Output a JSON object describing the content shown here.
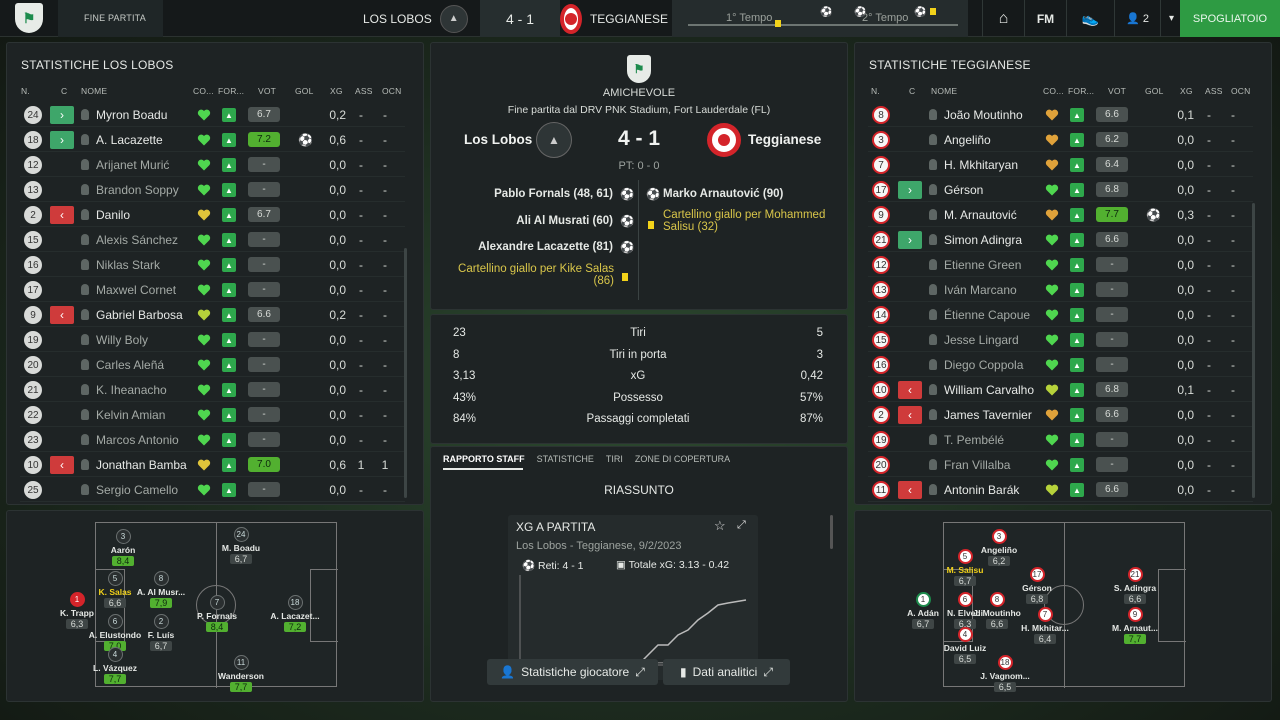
{
  "topbar": {
    "section": "FINE PARTITA",
    "home_team": "LOS LOBOS",
    "score": "4 - 1",
    "away_team": "TEGGIANESE",
    "first_half": "1° Tempo",
    "second_half": "2° Tempo",
    "fm": "FM",
    "users_count": "2",
    "dressing_room": "SPOGLIATOIO"
  },
  "left": {
    "title": "STATISTICHE LOS LOBOS",
    "headers": {
      "n": "N.",
      "c": "C",
      "name": "NOME",
      "co": "CO...",
      "form": "FOR...",
      "vot": "VOT",
      "gol": "GOL",
      "xg": "XG",
      "ass": "ASS",
      "ocn": "OCN"
    },
    "players": [
      {
        "n": "24",
        "sub": "in",
        "name": "Myron Boadu",
        "heart": "green",
        "vot": "6.7",
        "hi": false,
        "gol": "",
        "xg": "0,2",
        "ass": "-",
        "ocn": "-"
      },
      {
        "n": "18",
        "sub": "in",
        "name": "A. Lacazette",
        "heart": "green",
        "vot": "7.2",
        "hi": true,
        "gol": "⚽",
        "xg": "0,6",
        "ass": "-",
        "ocn": "-"
      },
      {
        "n": "12",
        "sub": "",
        "name": "Arijanet Murić",
        "heart": "green",
        "vot": "-",
        "hi": false,
        "gol": "",
        "xg": "0,0",
        "ass": "-",
        "ocn": "-"
      },
      {
        "n": "13",
        "sub": "",
        "name": "Brandon Soppy",
        "heart": "green",
        "vot": "-",
        "hi": false,
        "gol": "",
        "xg": "0,0",
        "ass": "-",
        "ocn": "-"
      },
      {
        "n": "2",
        "sub": "out",
        "name": "Danilo",
        "heart": "yellow",
        "vot": "6.7",
        "hi": false,
        "gol": "",
        "xg": "0,0",
        "ass": "-",
        "ocn": "-"
      },
      {
        "n": "15",
        "sub": "",
        "name": "Alexis Sánchez",
        "heart": "green",
        "vot": "-",
        "hi": false,
        "gol": "",
        "xg": "0,0",
        "ass": "-",
        "ocn": "-"
      },
      {
        "n": "16",
        "sub": "",
        "name": "Niklas Stark",
        "heart": "green",
        "vot": "-",
        "hi": false,
        "gol": "",
        "xg": "0,0",
        "ass": "-",
        "ocn": "-"
      },
      {
        "n": "17",
        "sub": "",
        "name": "Maxwel Cornet",
        "heart": "green",
        "vot": "-",
        "hi": false,
        "gol": "",
        "xg": "0,0",
        "ass": "-",
        "ocn": "-"
      },
      {
        "n": "9",
        "sub": "out",
        "name": "Gabriel Barbosa",
        "heart": "lime",
        "vot": "6.6",
        "hi": false,
        "gol": "",
        "xg": "0,2",
        "ass": "-",
        "ocn": "-"
      },
      {
        "n": "19",
        "sub": "",
        "name": "Willy Boly",
        "heart": "green",
        "vot": "-",
        "hi": false,
        "gol": "",
        "xg": "0,0",
        "ass": "-",
        "ocn": "-"
      },
      {
        "n": "20",
        "sub": "",
        "name": "Carles Aleñá",
        "heart": "green",
        "vot": "-",
        "hi": false,
        "gol": "",
        "xg": "0,0",
        "ass": "-",
        "ocn": "-"
      },
      {
        "n": "21",
        "sub": "",
        "name": "K. Iheanacho",
        "heart": "green",
        "vot": "-",
        "hi": false,
        "gol": "",
        "xg": "0,0",
        "ass": "-",
        "ocn": "-"
      },
      {
        "n": "22",
        "sub": "",
        "name": "Kelvin Amian",
        "heart": "green",
        "vot": "-",
        "hi": false,
        "gol": "",
        "xg": "0,0",
        "ass": "-",
        "ocn": "-"
      },
      {
        "n": "23",
        "sub": "",
        "name": "Marcos Antonio",
        "heart": "green",
        "vot": "-",
        "hi": false,
        "gol": "",
        "xg": "0,0",
        "ass": "-",
        "ocn": "-"
      },
      {
        "n": "10",
        "sub": "out",
        "name": "Jonathan Bamba",
        "heart": "yellow",
        "vot": "7.0",
        "hi": true,
        "gol": "",
        "xg": "0,6",
        "ass": "1",
        "ocn": "1"
      },
      {
        "n": "25",
        "sub": "",
        "name": "Sergio Camello",
        "heart": "green",
        "vot": "-",
        "hi": false,
        "gol": "",
        "xg": "0,0",
        "ass": "-",
        "ocn": "-"
      }
    ]
  },
  "right": {
    "title": "STATISTICHE TEGGIANESE",
    "headers": {
      "n": "N.",
      "c": "C",
      "name": "NOME",
      "co": "CO...",
      "form": "FOR...",
      "vot": "VOT",
      "gol": "GOL",
      "xg": "XG",
      "ass": "ASS",
      "ocn": "OCN"
    },
    "players": [
      {
        "n": "8",
        "sub": "",
        "name": "João Moutinho",
        "heart": "orange",
        "vot": "6.6",
        "hi": false,
        "gol": "",
        "xg": "0,1",
        "ass": "-",
        "ocn": "-"
      },
      {
        "n": "3",
        "sub": "",
        "name": "Angeliño",
        "heart": "orange",
        "vot": "6.2",
        "hi": false,
        "gol": "",
        "xg": "0,0",
        "ass": "-",
        "ocn": "-"
      },
      {
        "n": "7",
        "sub": "",
        "name": "H. Mkhitaryan",
        "heart": "orange",
        "vot": "6.4",
        "hi": false,
        "gol": "",
        "xg": "0,0",
        "ass": "-",
        "ocn": "-"
      },
      {
        "n": "17",
        "sub": "in",
        "name": "Gérson",
        "heart": "green",
        "vot": "6.8",
        "hi": false,
        "gol": "",
        "xg": "0,0",
        "ass": "-",
        "ocn": "-"
      },
      {
        "n": "9",
        "sub": "",
        "name": "M. Arnautović",
        "heart": "orange",
        "vot": "7.7",
        "hi": true,
        "gol": "⚽",
        "xg": "0,3",
        "ass": "-",
        "ocn": "-"
      },
      {
        "n": "21",
        "sub": "in",
        "name": "Simon Adingra",
        "heart": "green",
        "vot": "6.6",
        "hi": false,
        "gol": "",
        "xg": "0,0",
        "ass": "-",
        "ocn": "-"
      },
      {
        "n": "12",
        "sub": "",
        "name": "Etienne Green",
        "heart": "green",
        "vot": "-",
        "hi": false,
        "gol": "",
        "xg": "0,0",
        "ass": "-",
        "ocn": "-"
      },
      {
        "n": "13",
        "sub": "",
        "name": "Iván Marcano",
        "heart": "green",
        "vot": "-",
        "hi": false,
        "gol": "",
        "xg": "0,0",
        "ass": "-",
        "ocn": "-"
      },
      {
        "n": "14",
        "sub": "",
        "name": "Étienne Capoue",
        "heart": "green",
        "vot": "-",
        "hi": false,
        "gol": "",
        "xg": "0,0",
        "ass": "-",
        "ocn": "-"
      },
      {
        "n": "15",
        "sub": "",
        "name": "Jesse Lingard",
        "heart": "green",
        "vot": "-",
        "hi": false,
        "gol": "",
        "xg": "0,0",
        "ass": "-",
        "ocn": "-"
      },
      {
        "n": "16",
        "sub": "",
        "name": "Diego Coppola",
        "heart": "green",
        "vot": "-",
        "hi": false,
        "gol": "",
        "xg": "0,0",
        "ass": "-",
        "ocn": "-"
      },
      {
        "n": "10",
        "sub": "out",
        "name": "William Carvalho",
        "heart": "lime",
        "vot": "6.8",
        "hi": false,
        "gol": "",
        "xg": "0,1",
        "ass": "-",
        "ocn": "-"
      },
      {
        "n": "2",
        "sub": "out",
        "name": "James Tavernier",
        "heart": "orange",
        "vot": "6.6",
        "hi": false,
        "gol": "",
        "xg": "0,0",
        "ass": "-",
        "ocn": "-"
      },
      {
        "n": "19",
        "sub": "",
        "name": "T. Pembélé",
        "heart": "green",
        "vot": "-",
        "hi": false,
        "gol": "",
        "xg": "0,0",
        "ass": "-",
        "ocn": "-"
      },
      {
        "n": "20",
        "sub": "",
        "name": "Fran Villalba",
        "heart": "green",
        "vot": "-",
        "hi": false,
        "gol": "",
        "xg": "0,0",
        "ass": "-",
        "ocn": "-"
      },
      {
        "n": "11",
        "sub": "out",
        "name": "Antonin Barák",
        "heart": "lime",
        "vot": "6.6",
        "hi": false,
        "gol": "",
        "xg": "0,0",
        "ass": "-",
        "ocn": "-"
      }
    ]
  },
  "center": {
    "competition": "AMICHEVOLE",
    "venue": "Fine partita dal DRV PNK Stadium, Fort Lauderdale (FL)",
    "home": "Los Lobos",
    "away": "Teggianese",
    "score": "4 - 1",
    "halftime": "PT: 0 - 0",
    "home_events": [
      "Pablo Fornals (48, 61)",
      "Ali Al Musrati (60)",
      "Alexandre Lacazette (81)"
    ],
    "home_card": "Cartellino giallo per Kike Salas (86)",
    "away_goal": "Marko Arnautović (90)",
    "away_card": "Cartellino giallo per Mohammed Salisu (32)",
    "stats": [
      {
        "l": "23",
        "label": "Tiri",
        "r": "5"
      },
      {
        "l": "8",
        "label": "Tiri in porta",
        "r": "3"
      },
      {
        "l": "3,13",
        "label": "xG",
        "r": "0,42"
      },
      {
        "l": "43%",
        "label": "Possesso",
        "r": "57%"
      },
      {
        "l": "84%",
        "label": "Passaggi completati",
        "r": "87%"
      }
    ],
    "tabs": [
      "RAPPORTO STAFF",
      "STATISTICHE",
      "TIRI",
      "ZONE DI COPERTURA"
    ],
    "summary": "RIASSUNTO",
    "card": {
      "title": "XG A PARTITA",
      "subtitle": "Los Lobos - Teggianese, 9/2/2023",
      "goals": "Reti: 4 - 1",
      "xg_total": "Totale xG: 3.13 - 0.42"
    },
    "btn_players": "Statistiche giocatore",
    "btn_analytics": "Dati analitici"
  },
  "left_pitch": [
    {
      "num": "3",
      "name": "Aarón",
      "rate": "8,4",
      "hi": true,
      "y": false,
      "red": false
    },
    {
      "num": "24",
      "name": "M. Boadu",
      "rate": "6,7",
      "hi": false,
      "y": false,
      "red": false
    },
    {
      "num": "1",
      "name": "K. Trapp",
      "rate": "6,3",
      "hi": false,
      "y": false,
      "red": true
    },
    {
      "num": "5",
      "name": "K. Salas",
      "rate": "6,6",
      "hi": false,
      "y": true,
      "red": false
    },
    {
      "num": "8",
      "name": "A. Al Musr...",
      "rate": "7,9",
      "hi": true,
      "y": false,
      "red": false
    },
    {
      "num": "7",
      "name": "P. Fornals",
      "rate": "8,4",
      "hi": true,
      "y": false,
      "red": false
    },
    {
      "num": "18",
      "name": "A. Lacazet...",
      "rate": "7,2",
      "hi": true,
      "y": false,
      "red": false
    },
    {
      "num": "6",
      "name": "A. Elustondo",
      "rate": "7,0",
      "hi": true,
      "y": false,
      "red": false
    },
    {
      "num": "2",
      "name": "F. Luís",
      "rate": "6,7",
      "hi": false,
      "y": false,
      "red": false
    },
    {
      "num": "4",
      "name": "L. Vázquez",
      "rate": "7,7",
      "hi": true,
      "y": false,
      "red": false
    },
    {
      "num": "11",
      "name": "Wanderson",
      "rate": "7,7",
      "hi": true,
      "y": false,
      "red": false
    }
  ],
  "right_pitch": [
    {
      "num": "3",
      "name": "Angeliño",
      "rate": "6,2",
      "hi": false,
      "y": false,
      "g": false
    },
    {
      "num": "5",
      "name": "M. Salisu",
      "rate": "6,7",
      "hi": false,
      "y": true,
      "g": false
    },
    {
      "num": "17",
      "name": "Gérson",
      "rate": "6,8",
      "hi": false,
      "y": false,
      "g": false
    },
    {
      "num": "21",
      "name": "S. Adingra",
      "rate": "6,6",
      "hi": false,
      "y": false,
      "g": false
    },
    {
      "num": "1",
      "name": "A. Adán",
      "rate": "6,7",
      "hi": false,
      "y": false,
      "g": true
    },
    {
      "num": "6",
      "name": "N. Elvedi",
      "rate": "6,3",
      "hi": false,
      "y": false,
      "g": false
    },
    {
      "num": "8",
      "name": "J. Moutinho",
      "rate": "6,6",
      "hi": false,
      "y": false,
      "g": false
    },
    {
      "num": "7",
      "name": "H. Mkhitar...",
      "rate": "6,4",
      "hi": false,
      "y": false,
      "g": false
    },
    {
      "num": "9",
      "name": "M. Arnaut...",
      "rate": "7,7",
      "hi": true,
      "y": false,
      "g": false
    },
    {
      "num": "4",
      "name": "David Luiz",
      "rate": "6,5",
      "hi": false,
      "y": false,
      "g": false
    },
    {
      "num": "18",
      "name": "J. Vagnom...",
      "rate": "6,5",
      "hi": false,
      "y": false,
      "g": false
    }
  ],
  "colors": {
    "accent": "#2e9b43",
    "heart_green": "#4fd64f",
    "heart_yellow": "#e0c53a",
    "heart_orange": "#e0a23a",
    "heart_lime": "#b6d23a",
    "sub_in": "#3ea66a",
    "sub_out": "#cf3b3b"
  }
}
